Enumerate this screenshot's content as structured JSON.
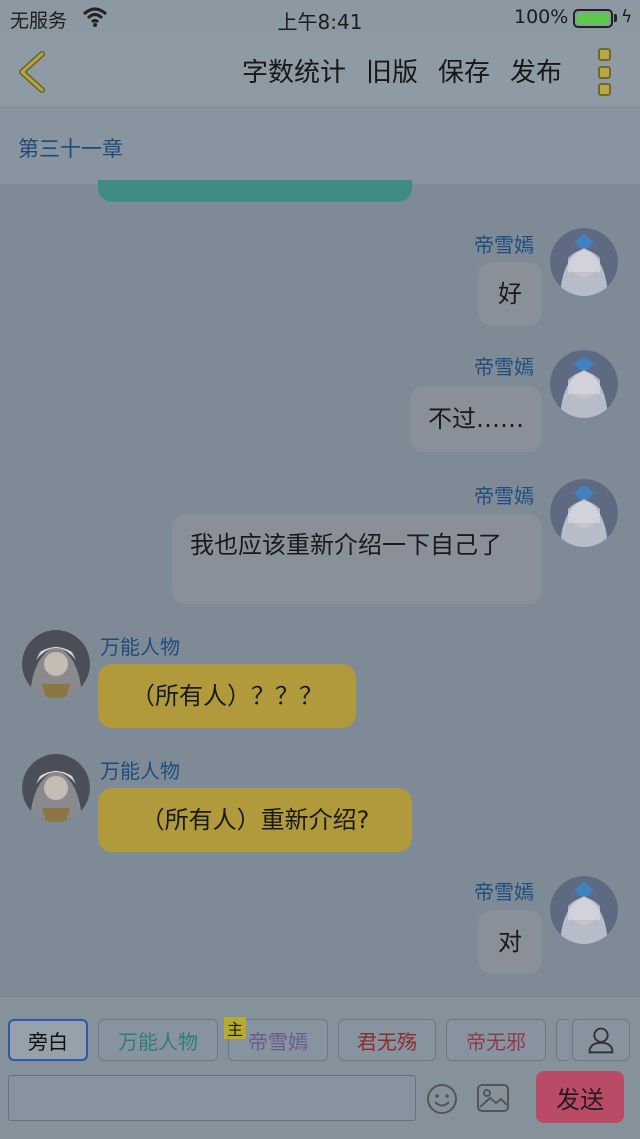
{
  "status_bar": {
    "carrier": "无服务",
    "time": "上午8:41",
    "battery_pct": "100%",
    "battery_level": 1.0
  },
  "nav": {
    "back_icon": "chevron-left-icon",
    "actions": [
      "字数统计",
      "旧版",
      "保存",
      "发布"
    ],
    "more_icon": "more-vertical-icon"
  },
  "chapter": {
    "title": "第三十一章"
  },
  "messages": [
    {
      "sender": "帝雪嫣",
      "side": "right",
      "text": "好"
    },
    {
      "sender": "帝雪嫣",
      "side": "right",
      "text": "不过……"
    },
    {
      "sender": "帝雪嫣",
      "side": "right",
      "text": "我也应该重新介绍一下自己了"
    },
    {
      "sender": "万能人物",
      "side": "left",
      "text": "（所有人）？？？"
    },
    {
      "sender": "万能人物",
      "side": "left",
      "text": "（所有人）重新介绍?"
    },
    {
      "sender": "帝雪嫣",
      "side": "right",
      "text": "对"
    }
  ],
  "characters": {
    "chips": [
      "旁白",
      "万能人物",
      "帝雪嫣",
      "君无殇",
      "帝无邪"
    ],
    "active": "旁白",
    "main_badge": "主",
    "chip_colors": [
      "#1a1a1a",
      "#2f7f70",
      "#6a5a8e",
      "#8e2c2c",
      "#8e3c4c"
    ]
  },
  "composer": {
    "input_value": "",
    "send_label": "发送",
    "emoji_icon": "smiley-icon",
    "image_icon": "image-icon",
    "person_icon": "person-icon"
  },
  "colors": {
    "overlay_bg": "#7e8b96",
    "right_bubble": "#8a9099",
    "left_bubble": "#b09a3c",
    "send_button": "#b94b66",
    "name_text": "#1f4d7e"
  }
}
